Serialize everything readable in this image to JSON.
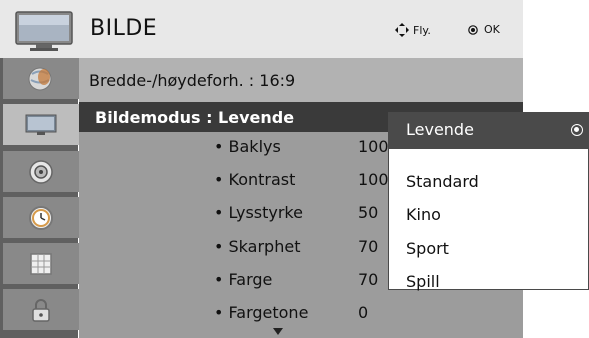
{
  "header": {
    "title": "BILDE",
    "nav_hint": "Fly.",
    "ok_hint": "OK",
    "icons": [
      "tv-icon",
      "move-arrows-icon",
      "ok-circle-icon"
    ]
  },
  "sidebar": {
    "items": [
      {
        "name": "globe-satellite-icon",
        "active": false
      },
      {
        "name": "tv-picture-icon",
        "active": true
      },
      {
        "name": "speaker-icon",
        "active": false
      },
      {
        "name": "clock-icon",
        "active": false
      },
      {
        "name": "grid-option-icon",
        "active": false
      },
      {
        "name": "lock-icon",
        "active": false
      }
    ]
  },
  "main": {
    "aspect_label": "Bredde-/høydeforh. : 16:9",
    "mode_label": "Bildemodus : Levende",
    "settings": [
      {
        "label": "• Baklys",
        "value": "100"
      },
      {
        "label": "• Kontrast",
        "value": "100"
      },
      {
        "label": "• Lysstyrke",
        "value": "50"
      },
      {
        "label": "• Skarphet",
        "value": "70"
      },
      {
        "label": "• Farge",
        "value": "70"
      },
      {
        "label": "• Fargetone",
        "value": "0"
      }
    ]
  },
  "dropdown": {
    "options": [
      "Levende",
      "Standard",
      "Kino",
      "Sport",
      "Spill"
    ],
    "selected": "Levende"
  },
  "colors": {
    "header_bg": "#e8e8e8",
    "main_bg": "#9c9c9c",
    "highlight_bg": "#3a3a3a",
    "sidebar_bg": "#606060"
  }
}
